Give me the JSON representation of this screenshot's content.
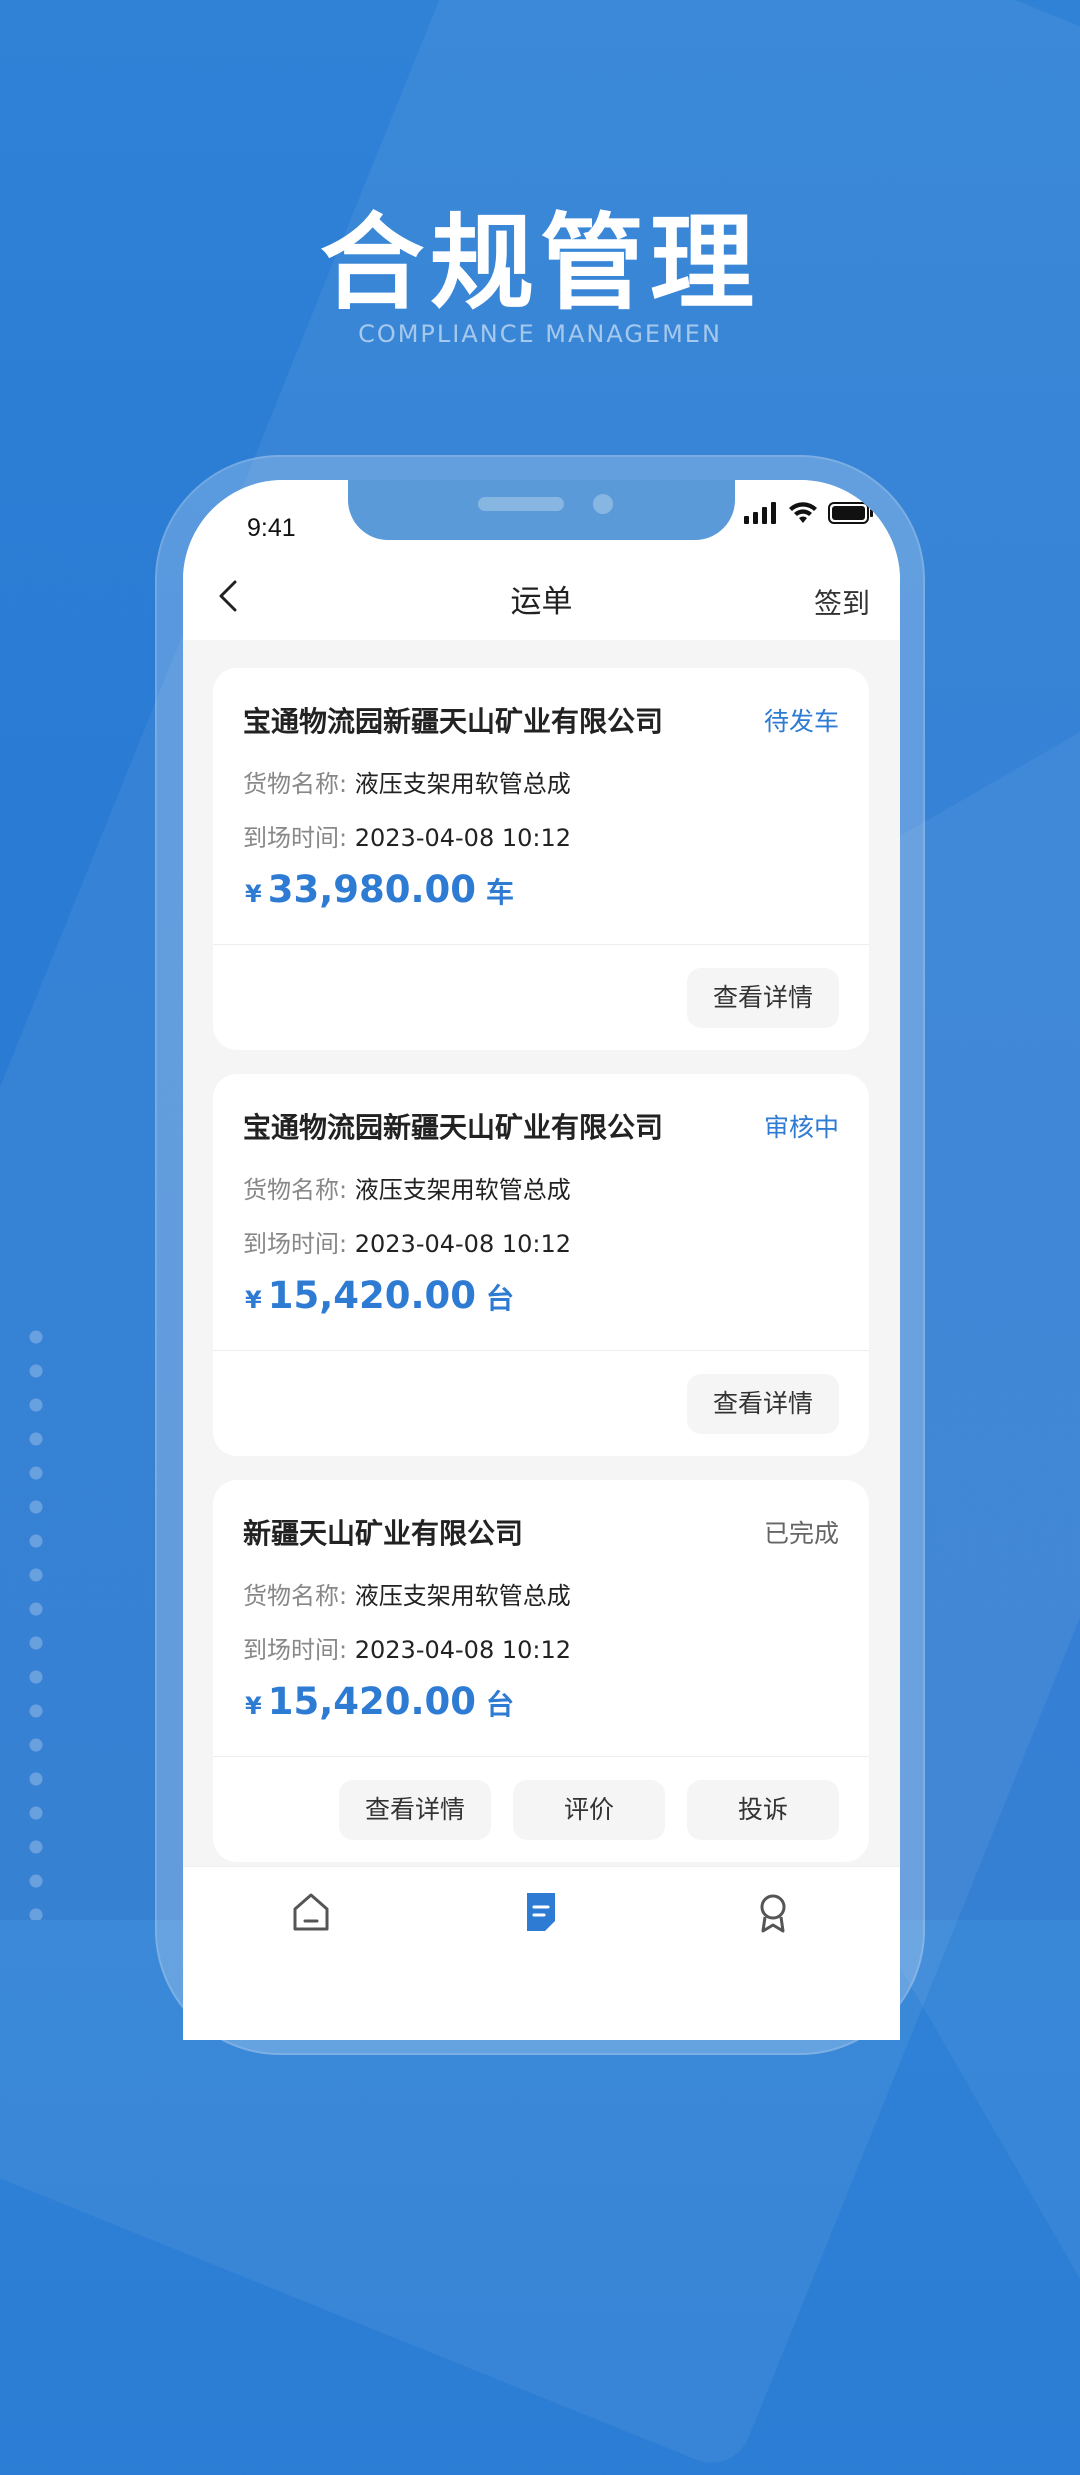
{
  "hero": {
    "title": "合规管理",
    "subtitle": "COMPLIANCE MANAGEMEN"
  },
  "status_bar": {
    "time": "9:41"
  },
  "nav": {
    "title": "运单",
    "right_label": "签到"
  },
  "labels": {
    "goods_name": "货物名称:",
    "arrival_time": "到场时间:",
    "currency": "¥"
  },
  "orders": [
    {
      "title": "宝通物流园新疆天山矿业有限公司",
      "status": "待发车",
      "goods_name": "液压支架用软管总成",
      "arrival_time": "2023-04-08  10:12",
      "amount": "33,980.00",
      "unit": "车",
      "actions": [
        "查看详情"
      ]
    },
    {
      "title": "宝通物流园新疆天山矿业有限公司",
      "status": "审核中",
      "goods_name": "液压支架用软管总成",
      "arrival_time": "2023-04-08  10:12",
      "amount": "15,420.00",
      "unit": "台",
      "actions": [
        "查看详情"
      ]
    },
    {
      "title": "新疆天山矿业有限公司",
      "status": "已完成",
      "goods_name": "液压支架用软管总成",
      "arrival_time": "2023-04-08  10:12",
      "amount": "15,420.00",
      "unit": "台",
      "actions": [
        "查看详情",
        "评价",
        "投诉"
      ]
    }
  ],
  "colors": {
    "accent": "#2e7bd3",
    "background": "#2b7ad1"
  },
  "tabs": [
    {
      "icon": "home-icon"
    },
    {
      "icon": "document-icon"
    },
    {
      "icon": "profile-icon"
    }
  ]
}
